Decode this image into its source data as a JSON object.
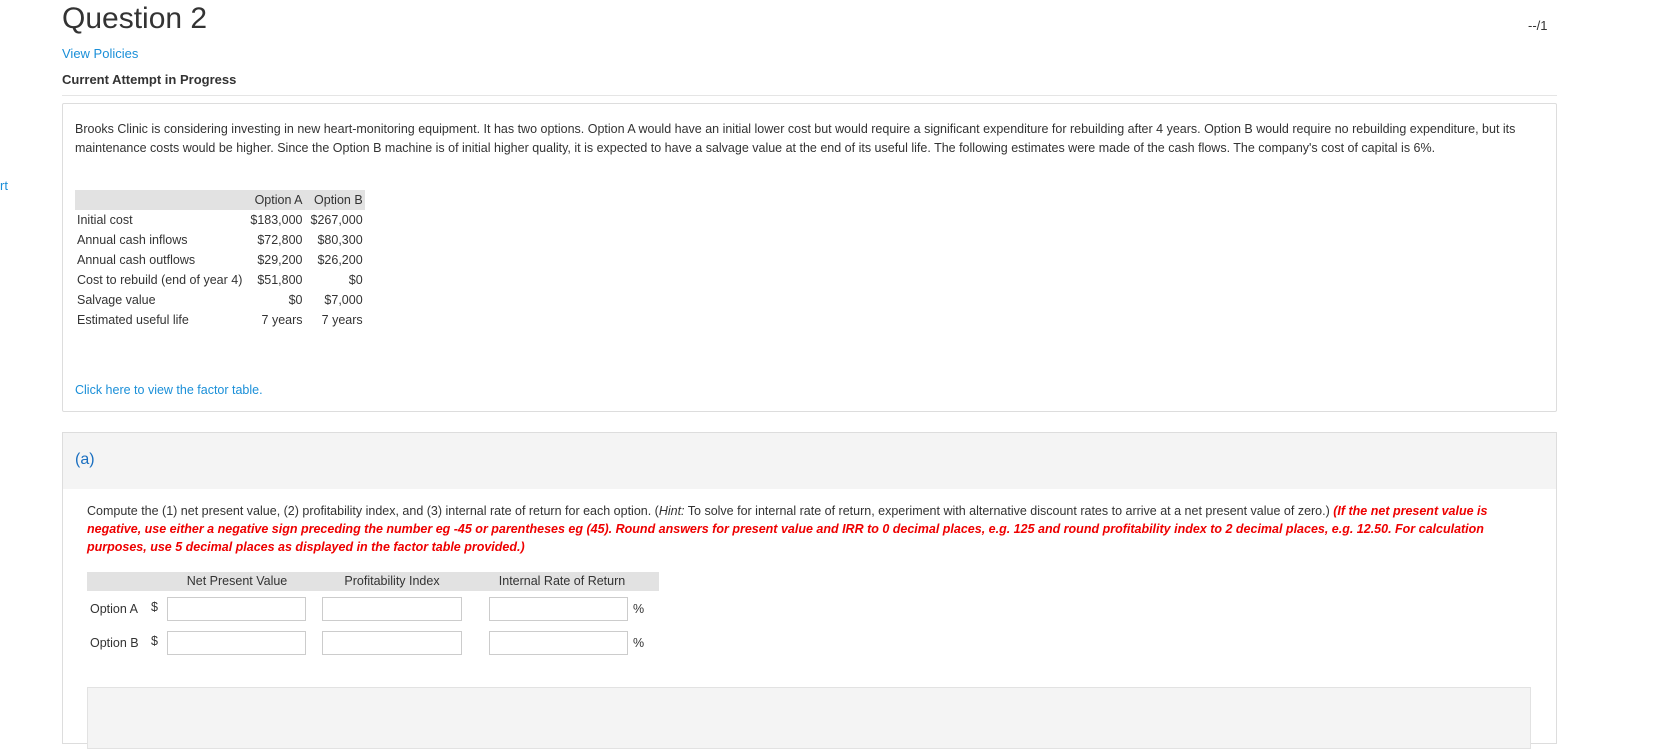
{
  "edge_text": "rt",
  "header": {
    "title": "Question 2",
    "score": "--/1",
    "view_policies": "View Policies",
    "attempt_status": "Current Attempt in Progress"
  },
  "problem": {
    "text": "Brooks Clinic is considering investing in new heart-monitoring equipment. It has two options. Option A would have an initial lower cost but would require a significant expenditure for rebuilding after 4 years. Option B would require no rebuilding expenditure, but its maintenance costs would be higher. Since the Option B machine is of initial higher quality, it is expected to have a salvage value at the end of its useful life. The following estimates were made of the cash flows. The company's cost of capital is 6%.",
    "columns": [
      "",
      "Option A",
      "Option B"
    ],
    "rows": [
      [
        "Initial cost",
        "$183,000",
        "$267,000"
      ],
      [
        "Annual cash inflows",
        "$72,800",
        "$80,300"
      ],
      [
        "Annual cash outflows",
        "$29,200",
        "$26,200"
      ],
      [
        "Cost to rebuild (end of year 4)",
        "$51,800",
        "$0"
      ],
      [
        "Salvage value",
        "$0",
        "$7,000"
      ],
      [
        "Estimated useful life",
        "7 years",
        "7 years"
      ]
    ],
    "factor_link": "Click here to view the factor table."
  },
  "part_a": {
    "label": "(a)",
    "instruction_prefix": "Compute the (1) net present value, (2) profitability index, and (3) internal rate of return for each option. (",
    "hint_label": "Hint:",
    "hint_text": " To solve for internal rate of return, experiment with alternative discount rates to arrive at a net present value of zero.)",
    "instruction_red": " (If the net present value is negative, use either a negative sign preceding the number eg -45 or parentheses eg (45). Round answers for present value and IRR to 0 decimal places, e.g. 125 and round profitability index to 2 decimal places, e.g. 12.50. For calculation purposes, use 5 decimal places as displayed in the factor table provided.)",
    "headers": [
      "Net Present Value",
      "Profitability Index",
      "Internal Rate of Return"
    ],
    "rows": [
      {
        "label": "Option A",
        "currency": "$",
        "npv": "",
        "pi": "",
        "irr": "",
        "unit": "%"
      },
      {
        "label": "Option B",
        "currency": "$",
        "npv": "",
        "pi": "",
        "irr": "",
        "unit": "%"
      }
    ]
  }
}
